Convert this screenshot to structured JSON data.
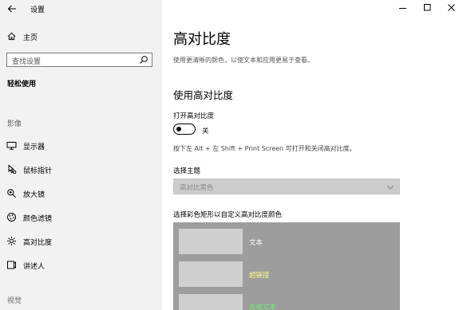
{
  "window": {
    "title": "设置"
  },
  "sidebar": {
    "home_label": "主页",
    "search_placeholder": "查找设置",
    "section_title": "轻松使用",
    "groups": [
      {
        "label": "影像"
      },
      {
        "label": "视觉"
      }
    ],
    "items": [
      {
        "label": "显示器",
        "icon": "display-icon"
      },
      {
        "label": "鼠标指针",
        "icon": "mouse-pointer-icon"
      },
      {
        "label": "放大镜",
        "icon": "magnifier-icon"
      },
      {
        "label": "颜色滤镜",
        "icon": "color-filter-icon"
      },
      {
        "label": "高对比度",
        "icon": "contrast-icon",
        "selected": true
      },
      {
        "label": "讲述人",
        "icon": "narrator-icon"
      }
    ]
  },
  "main": {
    "title": "高对比度",
    "description": "使用更清晰的颜色，以使文本和应用更易于查看。",
    "subheading": "使用高对比度",
    "toggle_label": "打开高对比度",
    "toggle_state": "关",
    "toggle_on": false,
    "shortcut_hint": "按下左 Alt + 左 Shift + Print Screen 可打开和关闭高对比度。",
    "theme_label": "选择主题",
    "theme_value": "高对比黑色",
    "swatch_label": "选择彩色矩形以自定义高对比度颜色",
    "swatches": [
      {
        "label": "文本",
        "color": "#ffffff"
      },
      {
        "label": "超链接",
        "color": "#ffff8a"
      },
      {
        "label": "失效文本",
        "color": "#6fef6f"
      }
    ]
  },
  "colors": {
    "sidebar_bg": "#f2f2f2",
    "preview_bg": "#9d9d9d",
    "swatch_bg": "#cfcfcf",
    "dropdown_bg": "#cccccc"
  }
}
